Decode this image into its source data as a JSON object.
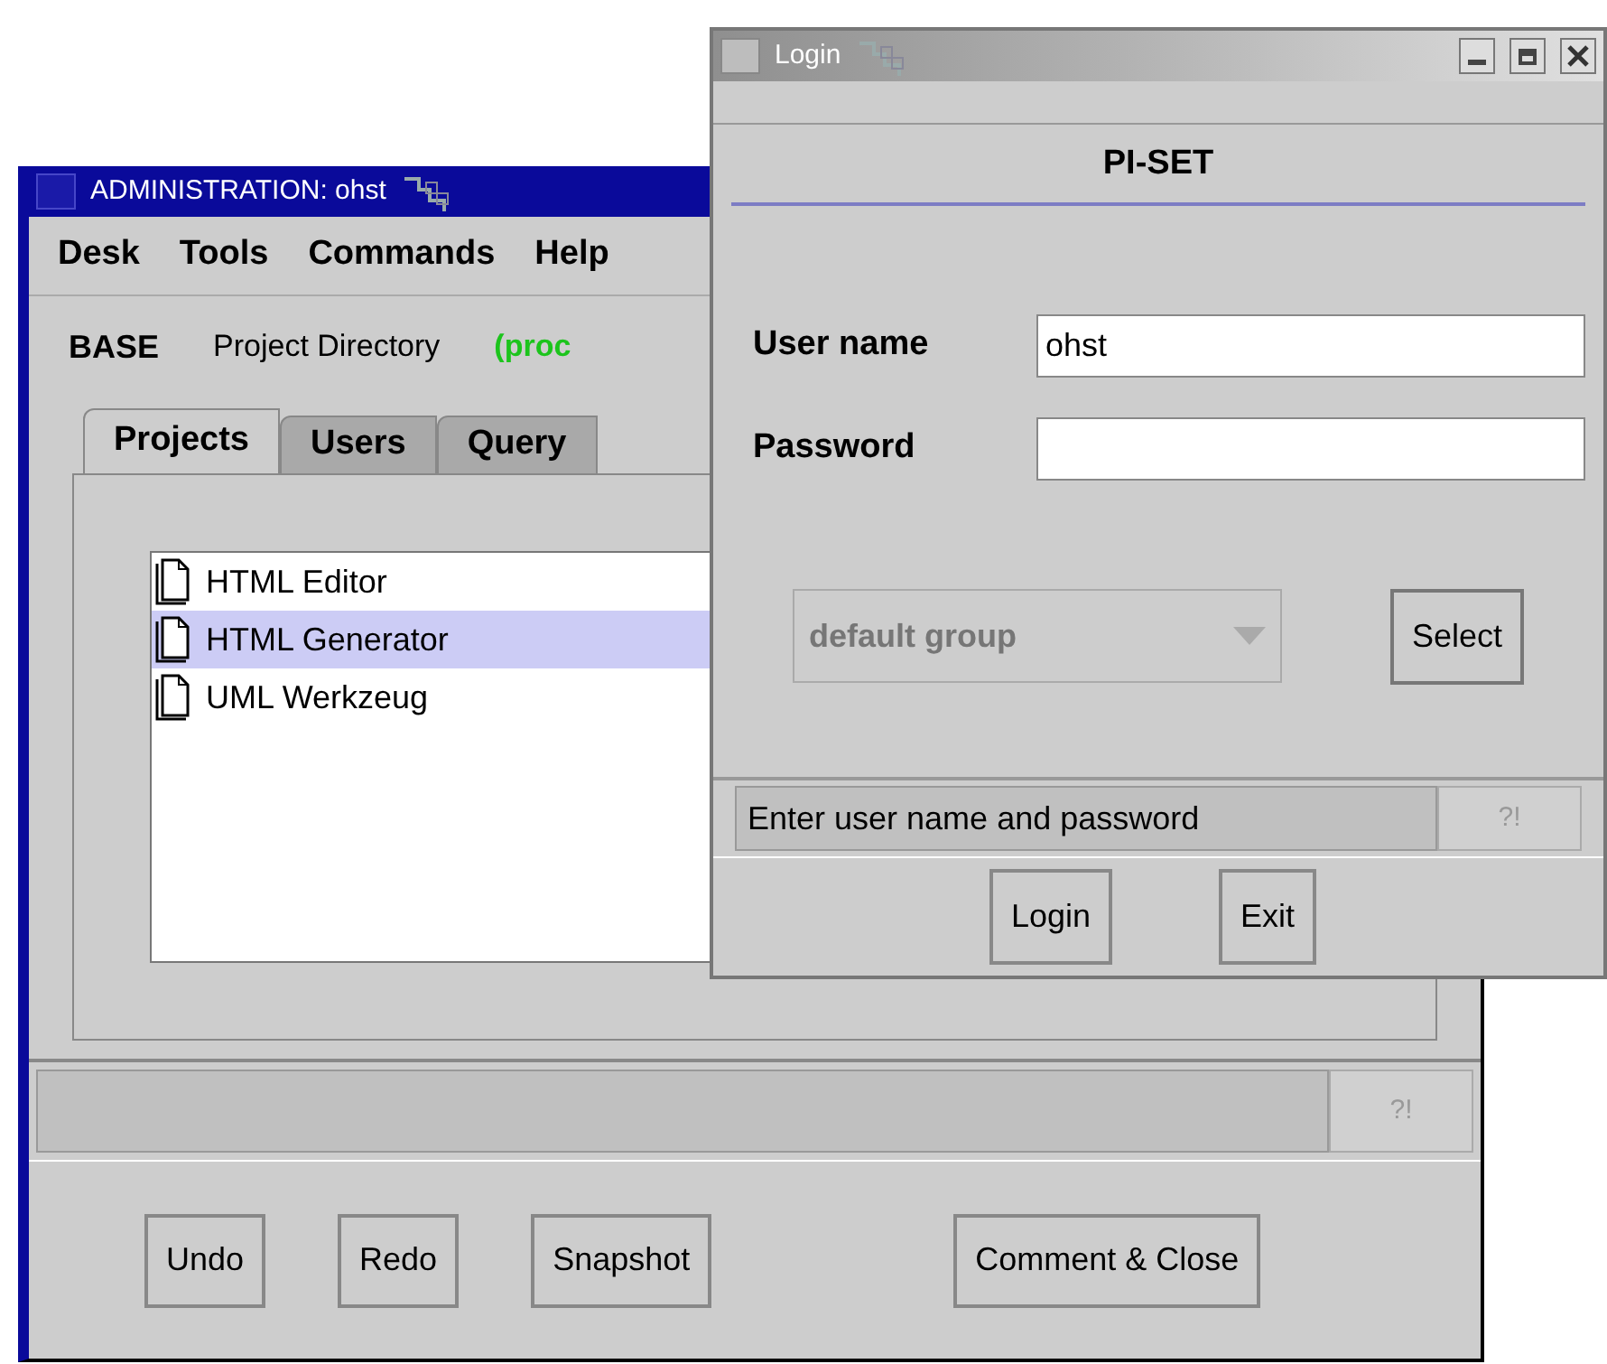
{
  "admin_window": {
    "title": "ADMINISTRATION: ohst",
    "menu": [
      "Desk",
      "Tools",
      "Commands",
      "Help"
    ],
    "info": {
      "base": "BASE",
      "directory": "Project Directory",
      "state": "(proc"
    },
    "tabs": [
      {
        "label": "Projects",
        "selected": true
      },
      {
        "label": "Users",
        "selected": false
      },
      {
        "label": "Query",
        "selected": false
      }
    ],
    "projects": [
      {
        "name": "HTML Editor",
        "selected": false
      },
      {
        "name": "HTML Generator",
        "selected": true
      },
      {
        "name": "UML Werkzeug",
        "selected": false
      }
    ],
    "status_bar": {
      "help_button": {
        "label": "?!",
        "disabled": true
      }
    },
    "buttons": [
      "Undo",
      "Redo",
      "Snapshot",
      "Comment & Close"
    ]
  },
  "login_window": {
    "title": "Login",
    "header": "PI-SET",
    "fields": [
      {
        "label": "User name",
        "value": "ohst"
      },
      {
        "label": "Password"
      }
    ],
    "group_select": {
      "value": "default group",
      "disabled": true
    },
    "select_button": "Select",
    "status_bar": {
      "message": "Enter user name and password",
      "help_button": {
        "label": "?!",
        "disabled": true
      }
    },
    "buttons": [
      "Login",
      "Exit"
    ]
  }
}
